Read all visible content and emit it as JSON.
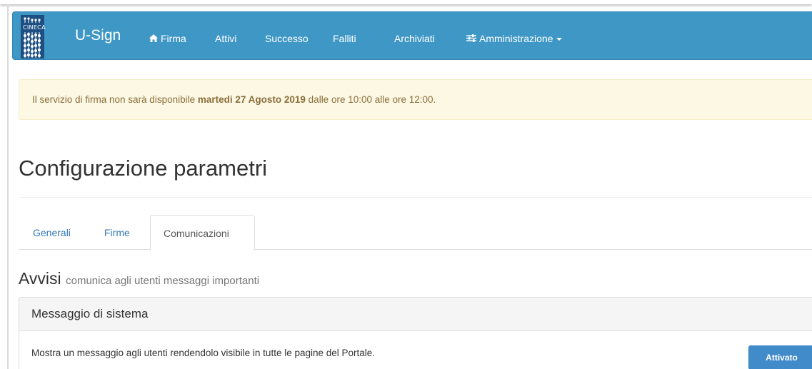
{
  "colors": {
    "navbar": "#3f97c5",
    "alert_bg": "#fcf8e3",
    "alert_text": "#8a6d3b",
    "link": "#337ab7",
    "primary_button": "#428bca"
  },
  "navbar": {
    "logo_text": "CINECA",
    "app_name": "U-Sign",
    "items": [
      {
        "label": "Firma",
        "icon": "home-icon"
      },
      {
        "label": "Attivi"
      },
      {
        "label": "Successo"
      },
      {
        "label": "Falliti"
      },
      {
        "label": "Archiviati"
      },
      {
        "label": "Amministrazione",
        "icon": "sliders-icon",
        "dropdown": true
      }
    ]
  },
  "alert": {
    "text_before": "Il servizio di firma non sarà disponibile ",
    "text_bold": "martedi 27 Agosto 2019",
    "text_after": " dalle ore 10:00 alle ore 12:00."
  },
  "page": {
    "title": "Configurazione parametri"
  },
  "tabs": [
    {
      "label": "Generali",
      "active": false
    },
    {
      "label": "Firme",
      "active": false
    },
    {
      "label": "Comunicazioni",
      "active": true
    }
  ],
  "section": {
    "heading": "Avvisi",
    "subheading": "comunica agli utenti messaggi importanti"
  },
  "panel": {
    "title": "Messaggio di sistema",
    "description": "Mostra un messaggio agli utenti rendendolo visibile in tutte le pagine del Portale.",
    "toggle_label": "Attivato"
  }
}
